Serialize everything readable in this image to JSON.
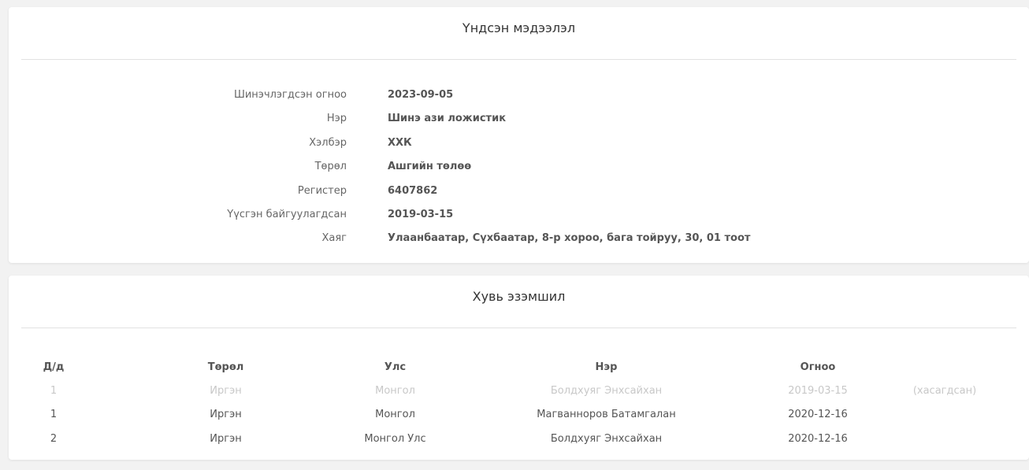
{
  "basic_info": {
    "title": "Үндсэн мэдээлэл",
    "rows": [
      {
        "label": "Шинэчлэгдсэн огноо",
        "value": "2023-09-05"
      },
      {
        "label": "Нэр",
        "value": "Шинэ ази ложистик"
      },
      {
        "label": "Хэлбэр",
        "value": "ХХК"
      },
      {
        "label": "Төрөл",
        "value": "Ашгийн төлөө"
      },
      {
        "label": "Регистер",
        "value": "6407862"
      },
      {
        "label": "Үүсгэн байгуулагдсан",
        "value": "2019-03-15"
      },
      {
        "label": "Хаяг",
        "value": "Улаанбаатар, Сүхбаатар, 8-р хороо, бага тойруу, 30, 01 тоот"
      }
    ]
  },
  "ownership": {
    "title": "Хувь эзэмшил",
    "columns": [
      "Д/д",
      "Төрөл",
      "Улс",
      "Нэр",
      "Огноо",
      ""
    ],
    "rows": [
      {
        "no": "1",
        "type": "Иргэн",
        "country": "Монгол",
        "name": "Болдхуяг Энхсайхан",
        "date": "2019-03-15",
        "status": "(хасагдсан)",
        "removed": true
      },
      {
        "no": "1",
        "type": "Иргэн",
        "country": "Монгол",
        "name": "Магванноров Батамгалан",
        "date": "2020-12-16",
        "status": "",
        "removed": false
      },
      {
        "no": "2",
        "type": "Иргэн",
        "country": "Монгол Улс",
        "name": "Болдхуяг Энхсайхан",
        "date": "2020-12-16",
        "status": "",
        "removed": false
      }
    ]
  },
  "colors": {
    "removed_text": "#c8c8c8",
    "status_removed": "#d0443c"
  }
}
